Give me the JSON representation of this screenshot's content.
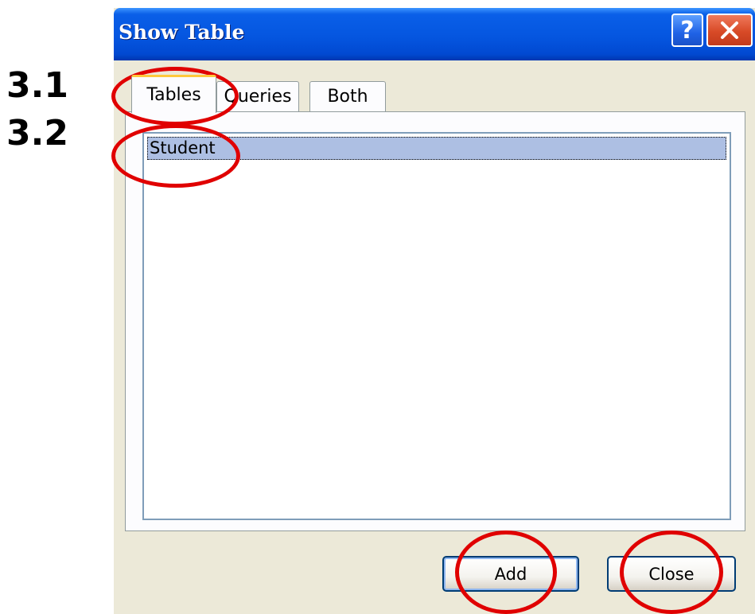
{
  "annotations": {
    "step_1": "3.1",
    "step_2": "3.2",
    "ring_color": "#e00000"
  },
  "dialog": {
    "title": "Show Table",
    "help_icon": "question-mark-icon",
    "close_icon": "close-x-icon",
    "help_glyph": "?",
    "tabs": [
      {
        "label": "Tables",
        "active": true
      },
      {
        "label": "Queries",
        "active": false
      },
      {
        "label": "Both",
        "active": false
      }
    ],
    "list": {
      "items": [
        {
          "label": "Student",
          "selected": true
        }
      ]
    },
    "buttons": {
      "add": "Add",
      "close": "Close"
    },
    "colors": {
      "titlebar": "#0556e0",
      "selection": "#adbfe3",
      "active_tab_accent": "#ffc83c",
      "face": "#ece9d8"
    }
  }
}
